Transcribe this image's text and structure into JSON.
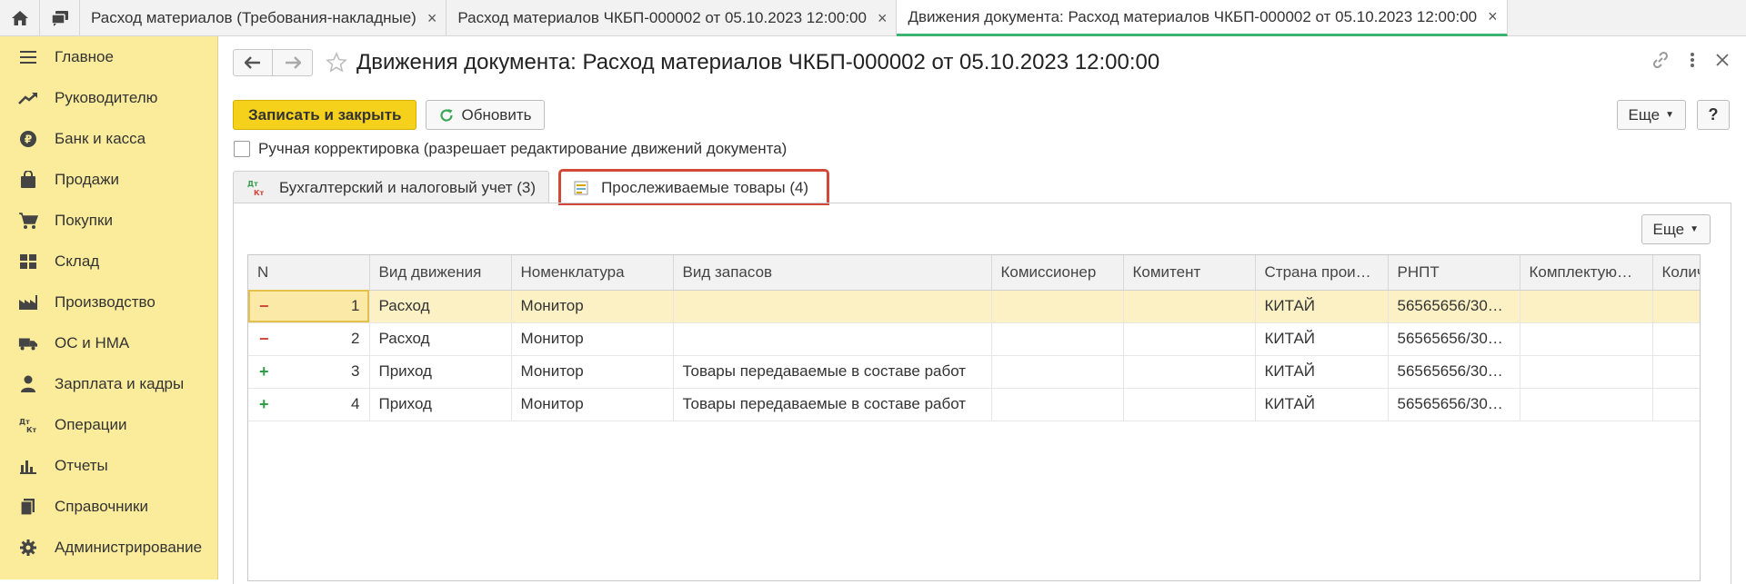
{
  "open_tabs": [
    {
      "label": "Расход материалов (Требования-накладные)",
      "active": false
    },
    {
      "label": "Расход материалов ЧКБП-000002 от 05.10.2023 12:00:00",
      "active": false
    },
    {
      "label": "Движения документа: Расход материалов ЧКБП-000002 от 05.10.2023 12:00:00",
      "active": true
    }
  ],
  "sidebar": {
    "items": [
      {
        "label": "Главное",
        "icon": "menu-icon"
      },
      {
        "label": "Руководителю",
        "icon": "trend-icon"
      },
      {
        "label": "Банк и касса",
        "icon": "ruble-icon"
      },
      {
        "label": "Продажи",
        "icon": "bag-icon"
      },
      {
        "label": "Покупки",
        "icon": "cart-icon"
      },
      {
        "label": "Склад",
        "icon": "warehouse-icon"
      },
      {
        "label": "Производство",
        "icon": "factory-icon"
      },
      {
        "label": "ОС и НМА",
        "icon": "truck-icon"
      },
      {
        "label": "Зарплата и кадры",
        "icon": "person-icon"
      },
      {
        "label": "Операции",
        "icon": "dt-kt-icon"
      },
      {
        "label": "Отчеты",
        "icon": "bar-chart-icon"
      },
      {
        "label": "Справочники",
        "icon": "books-icon"
      },
      {
        "label": "Администрирование",
        "icon": "gear-icon"
      }
    ]
  },
  "header": {
    "title": "Движения документа: Расход материалов ЧКБП-000002 от 05.10.2023 12:00:00"
  },
  "toolbar": {
    "save_close": "Записать и закрыть",
    "refresh": "Обновить",
    "more": "Еще",
    "help": "?"
  },
  "manual_adjust": {
    "label": "Ручная корректировка (разрешает редактирование движений документа)",
    "checked": false
  },
  "form_tabs": [
    {
      "label": "Бухгалтерский и налоговый учет (3)",
      "icon_text_top": "Дт",
      "icon_text_bottom": "Кт"
    },
    {
      "label": "Прослеживаемые товары (4)"
    }
  ],
  "panel": {
    "more": "Еще"
  },
  "table": {
    "columns": [
      "N",
      "Вид движения",
      "Номенклатура",
      "Вид запасов",
      "Комиссионер",
      "Комитент",
      "Страна проис…",
      "РНПТ",
      "Комплектующ…",
      "Колич"
    ],
    "rows": [
      {
        "sign": "−",
        "n": "1",
        "movement": "Расход",
        "item": "Монитор",
        "stock_type": "",
        "commissioner": "",
        "committent": "",
        "country": "КИТАЙ",
        "rnpt": "56565656/300…",
        "component": "",
        "qty": ""
      },
      {
        "sign": "−",
        "n": "2",
        "movement": "Расход",
        "item": "Монитор",
        "stock_type": "",
        "commissioner": "",
        "committent": "",
        "country": "КИТАЙ",
        "rnpt": "56565656/300…",
        "component": "",
        "qty": ""
      },
      {
        "sign": "+",
        "n": "3",
        "movement": "Приход",
        "item": "Монитор",
        "stock_type": "Товары передаваемые в составе работ",
        "commissioner": "",
        "committent": "",
        "country": "КИТАЙ",
        "rnpt": "56565656/300…",
        "component": "",
        "qty": ""
      },
      {
        "sign": "+",
        "n": "4",
        "movement": "Приход",
        "item": "Монитор",
        "stock_type": "Товары передаваемые в составе работ",
        "commissioner": "",
        "committent": "",
        "country": "КИТАЙ",
        "rnpt": "56565656/300…",
        "component": "",
        "qty": ""
      }
    ]
  },
  "colors": {
    "sidebar_bg": "#fbec9c",
    "primary_button": "#f5d11b",
    "highlight_border": "#d2493a",
    "active_tab_underline": "#3cb371",
    "minus": "#d2493a",
    "plus": "#2e9e47"
  }
}
